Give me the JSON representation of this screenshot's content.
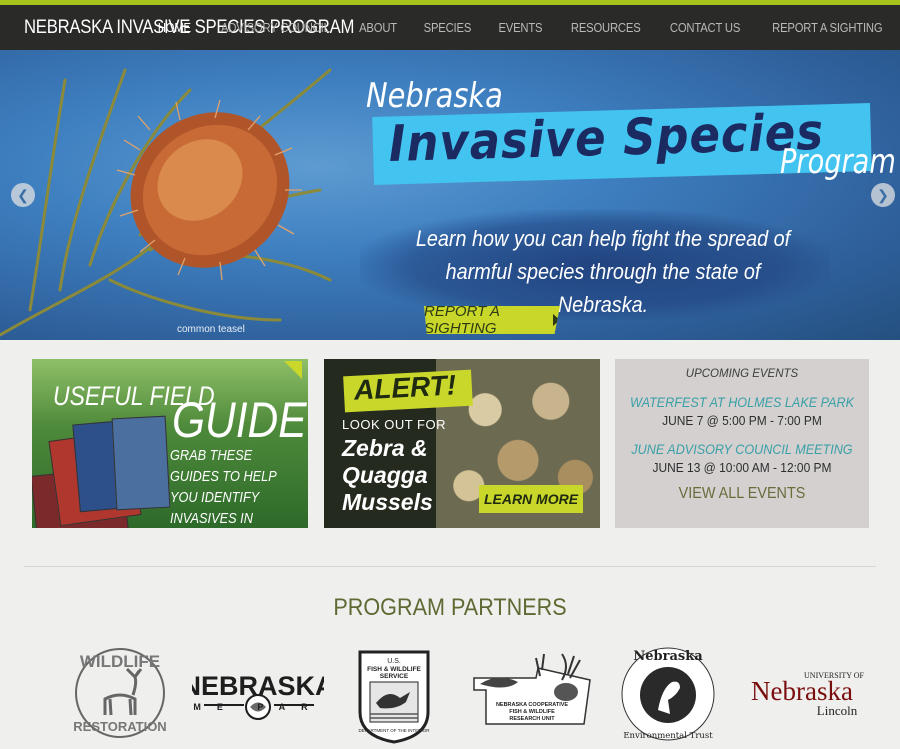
{
  "header": {
    "site_title": "NEBRASKA INVASIVE SPECIES PROGRAM",
    "nav": [
      {
        "label": "HOME",
        "active": true
      },
      {
        "label": "ADVISORY COUNCIL"
      },
      {
        "label": "ABOUT"
      },
      {
        "label": "SPECIES"
      },
      {
        "label": "EVENTS"
      },
      {
        "label": "RESOURCES"
      },
      {
        "label": "CONTACT US"
      },
      {
        "label": "REPORT A SIGHTING"
      }
    ]
  },
  "hero": {
    "title_line1": "Nebraska",
    "title_line2": "Invasive Species",
    "title_line3": "Program",
    "tagline": "Learn how you can help fight the spread of harmful species through the state of Nebraska.",
    "image_caption": "common teasel",
    "cta_label": "REPORT A SIGHTING",
    "prev_icon": "chevron-left-icon",
    "next_icon": "chevron-right-icon"
  },
  "promos": {
    "guides": {
      "heading1": "USEFUL FIELD",
      "heading2": "GUIDES",
      "text": "GRAB THESE GUIDES TO HELP YOU IDENTIFY INVASIVES IN NEBRASKA"
    },
    "alert": {
      "badge": "ALERT!",
      "lookout": "LOOK OUT FOR",
      "species": "Zebra & Quagga Mussels",
      "button": "LEARN MORE"
    },
    "events": {
      "title": "UPCOMING EVENTS",
      "items": [
        {
          "name": "WATERFEST AT HOLMES LAKE PARK",
          "date": "JUNE 7 @ 5:00 PM - 7:00 PM"
        },
        {
          "name": "JUNE ADVISORY COUNCIL MEETING",
          "date": "JUNE 13 @ 10:00 AM - 12:00 PM"
        }
      ],
      "view_all": "VIEW ALL EVENTS"
    }
  },
  "partners": {
    "title": "PROGRAM PARTNERS",
    "logos": {
      "wildlife_top": "WILDLIFE",
      "wildlife_bottom": "RESTORATION",
      "ngp_name": "NEBRASKA",
      "ngp_sub": "GAME PARKS",
      "usfws_top": "U.S.",
      "usfws_mid": "FISH & WILDLIFE",
      "usfws_bot": "SERVICE",
      "usfws_ring": "DEPARTMENT OF THE INTERIOR",
      "coop_line1": "NEBRASKA COOPERATIVE",
      "coop_line2": "FISH & WILDLIFE",
      "coop_line3": "RESEARCH UNIT",
      "net_top": "Nebraska",
      "net_bottom": "Environmental Trust",
      "unl_univ": "UNIVERSITY OF",
      "unl_name": "Nebraska",
      "unl_city": "Lincoln"
    }
  }
}
